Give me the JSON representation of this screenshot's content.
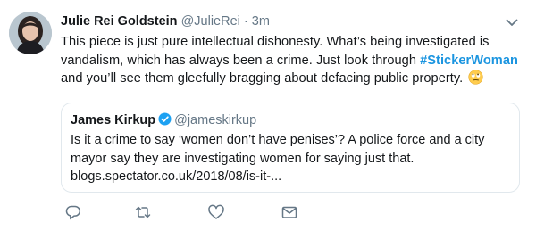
{
  "tweet": {
    "author_name": "Julie Rei Goldstein",
    "handle": "@JulieRei",
    "separator": "·",
    "timestamp": "3m",
    "text_before_hashtag": "This piece is just pure intellectual dishonesty. What’s being investigated is vandalism, which has always been a crime. Just look through ",
    "hashtag": "#StickerWoman",
    "text_after_hashtag": " and you’ll see them gleefully bragging about defacing public property. ",
    "emoji_icon": "eye-roll-emoji-icon",
    "hashtag_color": "#1b95e0"
  },
  "quoted_tweet": {
    "author_name": "James Kirkup",
    "handle": "@jameskirkup",
    "verified": true,
    "text": "Is it a crime to say ‘women don’t have penises’?  A police force and a city mayor say they are investigating women for saying just that. blogs.spectator.co.uk/2018/08/is-it-..."
  },
  "actions": {
    "icons": [
      "reply-icon",
      "retweet-icon",
      "like-icon",
      "direct-message-icon"
    ]
  },
  "colors": {
    "secondary_text": "#657786",
    "border": "#e1e8ed",
    "verified_badge": "#1da1f2"
  }
}
